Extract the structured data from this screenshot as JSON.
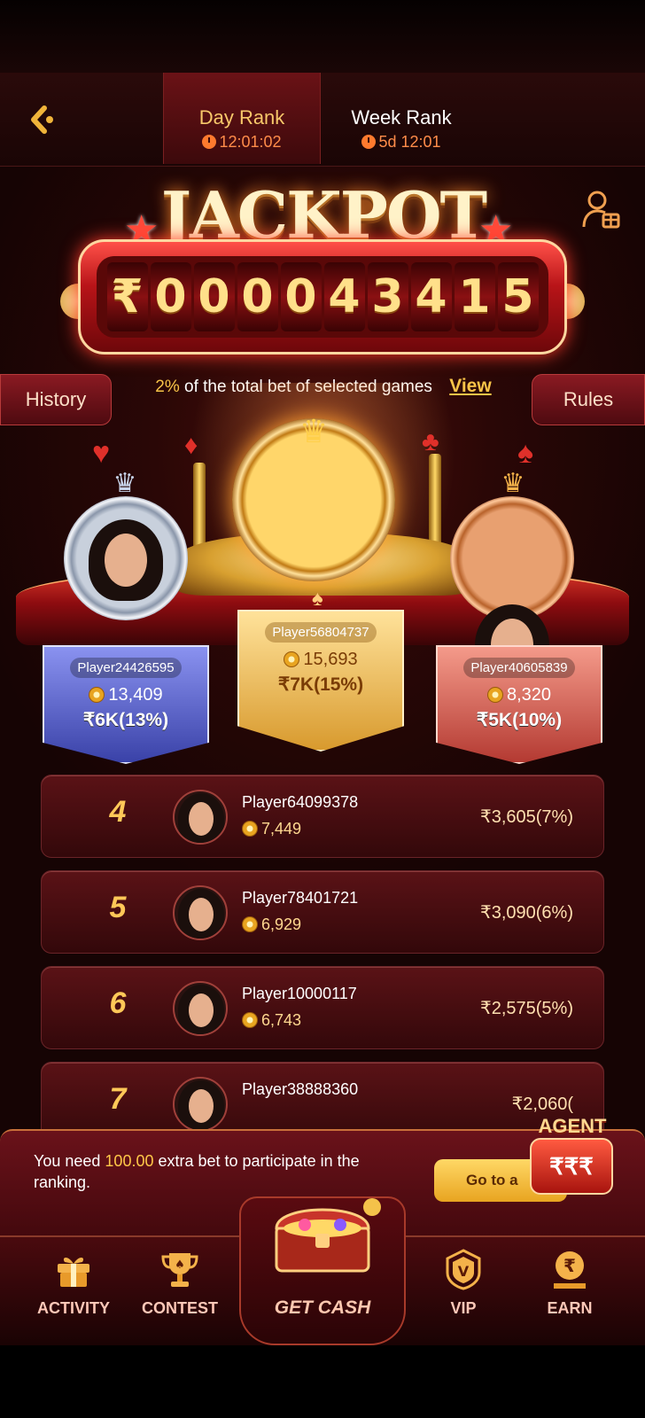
{
  "header": {
    "tabs": [
      {
        "label": "Day Rank",
        "time": "12:01:02"
      },
      {
        "label": "Week Rank",
        "time": "5d 12:01"
      }
    ]
  },
  "jackpot": {
    "title": "JACKPOT",
    "currency": "₹",
    "digits": [
      "0",
      "0",
      "0",
      "0",
      "4",
      "3",
      "4",
      "1",
      "5"
    ]
  },
  "info": {
    "percent": "2%",
    "text": "of the total bet of selected games",
    "view_label": "View"
  },
  "side_buttons": {
    "history": "History",
    "rules": "Rules"
  },
  "podium": [
    {
      "rank": "2",
      "name": "Player24426595",
      "coins": "13,409",
      "prize": "₹6K(13%)"
    },
    {
      "rank": "1",
      "name": "Player56804737",
      "coins": "15,693",
      "prize": "₹7K(15%)"
    },
    {
      "rank": "3",
      "name": "Player40605839",
      "coins": "8,320",
      "prize": "₹5K(10%)"
    }
  ],
  "rows": [
    {
      "rank": "4",
      "name": "Player64099378",
      "coins": "7,449",
      "prize": "₹3,605(7%)"
    },
    {
      "rank": "5",
      "name": "Player78401721",
      "coins": "6,929",
      "prize": "₹3,090(6%)"
    },
    {
      "rank": "6",
      "name": "Player10000117",
      "coins": "6,743",
      "prize": "₹2,575(5%)"
    },
    {
      "rank": "7",
      "name": "Player38888360",
      "coins": "",
      "prize": "₹2,060("
    }
  ],
  "banner": {
    "prefix": "You need ",
    "amount": "100.00",
    "suffix": " extra bet to participate in the ranking.",
    "button": "Go to a",
    "agent_label": "AGENT",
    "agent_symbols": "₹₹₹"
  },
  "nav": {
    "activity": "ACTIVITY",
    "contest": "CONTEST",
    "getcash": "GET CASH",
    "vip": "VIP",
    "earn": "EARN"
  },
  "colors": {
    "accent_gold": "#f8c448",
    "background": "#2a0706",
    "tab_active": "#6a1216"
  },
  "icons": [
    "back-arrow-icon",
    "clock-icon",
    "invite-gift-icon",
    "coin-icon",
    "crown-icon",
    "gift-icon",
    "trophy-icon",
    "treasure-chest-icon",
    "vip-shield-icon",
    "rupee-icon"
  ]
}
